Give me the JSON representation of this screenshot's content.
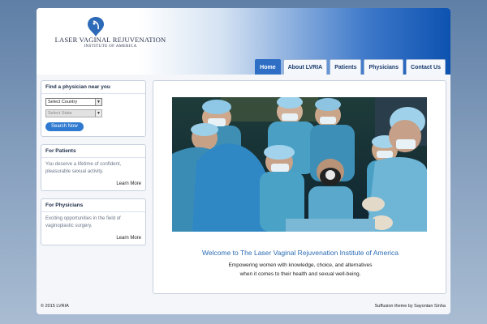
{
  "header": {
    "logo_title": "LASER VAGINAL REJUVENATION",
    "logo_subtitle": "INSTITUTE OF AMERICA",
    "nav": [
      {
        "label": "Home",
        "active": true
      },
      {
        "label": "About LVRIA",
        "active": false
      },
      {
        "label": "Patients",
        "active": false
      },
      {
        "label": "Physicians",
        "active": false
      },
      {
        "label": "Contact Us",
        "active": false
      }
    ]
  },
  "sidebar": {
    "finder": {
      "title": "Find a physician near you",
      "country_value": "Select Country",
      "state_value": "Select State",
      "button": "Search Now"
    },
    "patients": {
      "title": "For Patients",
      "text": "You deserve a lifetime of confident, pleasurable sexual activity.",
      "link": "Learn More"
    },
    "physicians": {
      "title": "For Physicians",
      "text": "Exciting opportunities in the field of vaginoplastic surgery.",
      "link": "Learn More"
    }
  },
  "main": {
    "welcome": "Welcome to The Laser Vaginal Rejuvenation Institute of America",
    "tagline_line1": "Empowering women with knowledge, choice, and alternatives",
    "tagline_line2": "when it comes to their health and sexual well-being."
  },
  "footer": {
    "copyright": "© 2015 LVRIA",
    "credit": "Suffusion theme by Sayontan Sinha"
  },
  "colors": {
    "accent": "#2e6fc5",
    "link_heading": "#2c6cb3",
    "scrubs": "#4fa3c9"
  }
}
